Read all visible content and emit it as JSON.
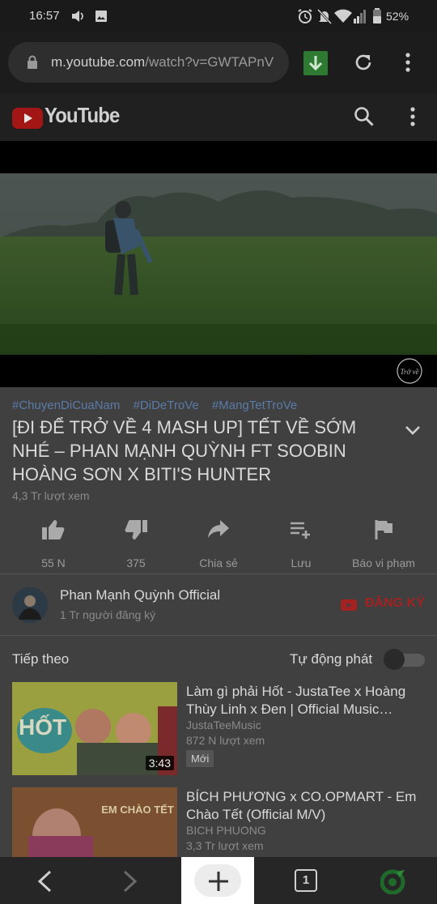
{
  "status_bar": {
    "time": "16:57",
    "battery": "52%"
  },
  "browser": {
    "url_host": "m.youtube.com",
    "url_path": "/watch?v=GWTAPnV"
  },
  "youtube": {
    "logo_text": "YouTube"
  },
  "video": {
    "hashtags": [
      "#ChuyenDiCuaNam",
      "#DiDeTroVe",
      "#MangTetTroVe"
    ],
    "title": "[ĐI ĐỂ TRỞ VỀ 4 MASH UP] TẾT VỀ SỚM NHÉ – PHAN MẠNH QUỲNH FT SOOBIN HOÀNG SƠN X BITI'S HUNTER",
    "views": "4,3 Tr lượt xem",
    "watermark": "Trở về"
  },
  "actions": {
    "like": "55 N",
    "dislike": "375",
    "share": "Chia sẻ",
    "save": "Lưu",
    "report": "Báo vi phạm"
  },
  "channel": {
    "name": "Phan Mạnh Quỳnh Official",
    "subs": "1 Tr người đăng ký",
    "subscribe": "ĐĂNG KÝ"
  },
  "up_next": {
    "label": "Tiếp theo",
    "autoplay": "Tự động phát",
    "autoplay_on": false
  },
  "recommendations": [
    {
      "title": "Làm gì phải Hốt - JustaTee x Hoàng Thùy Linh x Đen | Official Music…",
      "channel": "JustaTeeMusic",
      "views": "872 N lượt xem",
      "badge": "Mới",
      "duration": "3:43",
      "thumb_text": "HỐT"
    },
    {
      "title": "BÍCH PHƯƠNG x CO.OPMART - Em Chào Tết (Official M/V)",
      "channel": "BICH PHUONG",
      "views": "3,3 Tr lượt xem",
      "thumb_text": "EM CHÀO TẾT"
    }
  ],
  "bottom_nav": {
    "tab_count": "1"
  }
}
